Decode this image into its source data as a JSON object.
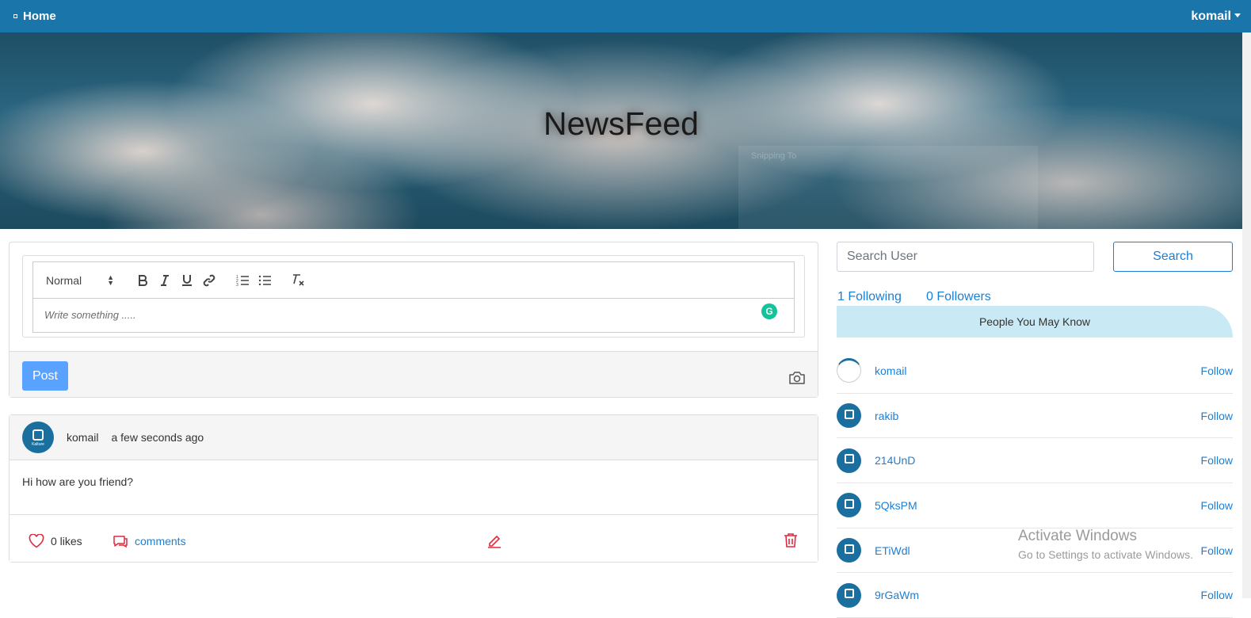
{
  "navbar": {
    "home_label": "Home",
    "user_label": "komail",
    "bg_color": "#1a75ab"
  },
  "hero": {
    "title": "NewsFeed",
    "snip_text": "Snipping To"
  },
  "editor": {
    "format_select": "Normal",
    "toolbar_icons": [
      "bold-icon",
      "italic-icon",
      "underline-icon",
      "link-icon",
      "ordered-list-icon",
      "bullet-list-icon",
      "clear-format-icon"
    ],
    "placeholder": "Write something .....",
    "post_button": "Post",
    "grammarly_letter": "G"
  },
  "post": {
    "author": "komail",
    "time": "a few seconds ago",
    "body": "Hi how are you friend?",
    "likes": "0 likes",
    "comments": "comments",
    "avatar_text": "Kalture"
  },
  "sidebar": {
    "search_placeholder": "Search User",
    "search_button": "Search",
    "following": "1 Following",
    "followers": "0 Followers",
    "people_heading": "People You May Know",
    "follow_label": "Follow",
    "people": [
      {
        "name": "komail"
      },
      {
        "name": "rakib"
      },
      {
        "name": "214UnD"
      },
      {
        "name": "5QksPM"
      },
      {
        "name": "ETiWdl"
      },
      {
        "name": "9rGaWm"
      }
    ]
  },
  "watermark": {
    "line1": "Activate Windows",
    "line2": "Go to Settings to activate Windows."
  },
  "colors": {
    "accent": "#1b7fd6",
    "post_button": "#5aa2ff",
    "danger": "#e0293e",
    "pymk_bg": "#c9eaf5"
  }
}
